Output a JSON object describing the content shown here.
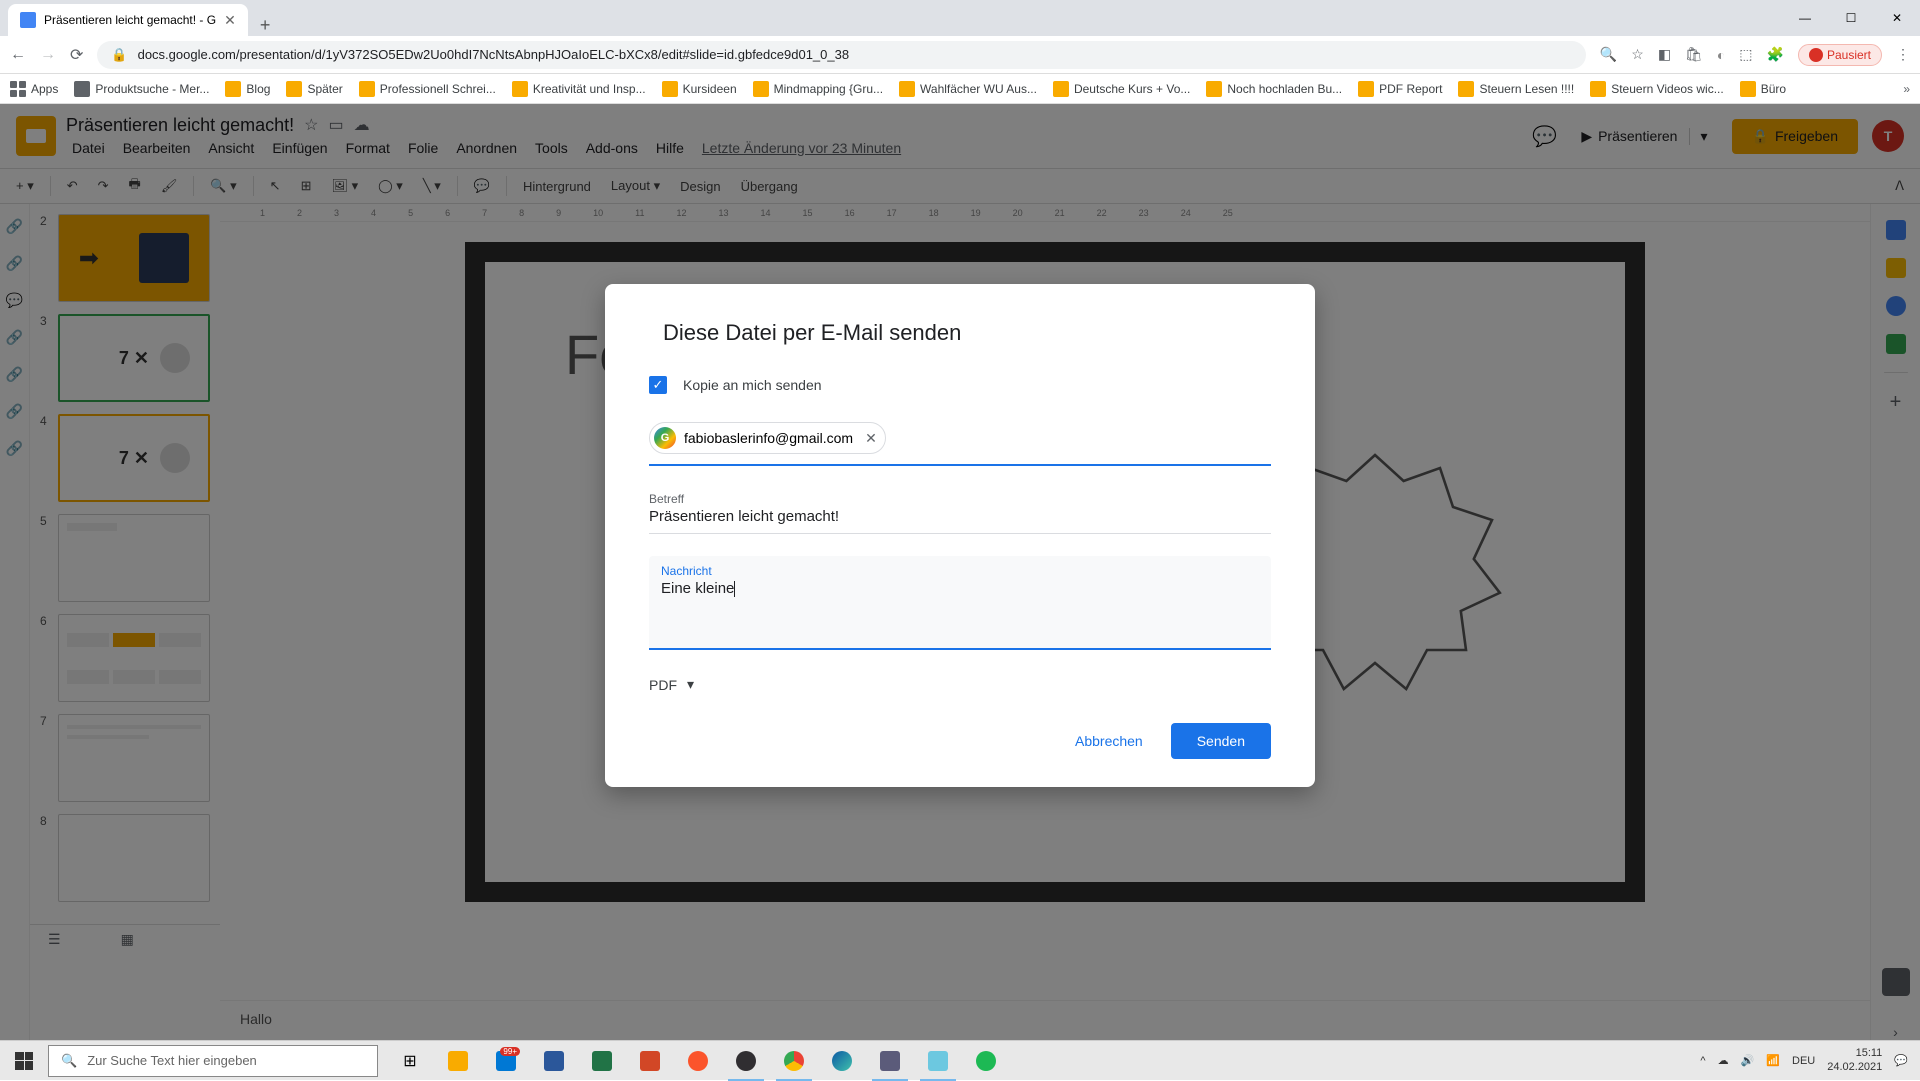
{
  "browser": {
    "tab_title": "Präsentieren leicht gemacht! - G",
    "url": "docs.google.com/presentation/d/1yV372SO5EDw2Uo0hdI7NcNtsAbnpHJOaIoELC-bXCx8/edit#slide=id.gbfedce9d01_0_38",
    "profile_status": "Pausiert",
    "window": {
      "minimize": "—",
      "maximize": "☐",
      "close": "✕"
    }
  },
  "bookmarks": {
    "apps": "Apps",
    "items": [
      "Produktsuche - Mer...",
      "Blog",
      "Später",
      "Professionell Schrei...",
      "Kreativität und Insp...",
      "Kursideen",
      "Mindmapping {Gru...",
      "Wahlfächer WU Aus...",
      "Deutsche Kurs + Vo...",
      "Noch hochladen Bu...",
      "PDF Report",
      "Steuern Lesen !!!!",
      "Steuern Videos wic...",
      "Büro"
    ]
  },
  "slides": {
    "doc_title": "Präsentieren leicht gemacht!",
    "menus": [
      "Datei",
      "Bearbeiten",
      "Ansicht",
      "Einfügen",
      "Format",
      "Folie",
      "Anordnen",
      "Tools",
      "Add-ons",
      "Hilfe"
    ],
    "last_edit": "Letzte Änderung vor 23 Minuten",
    "present": "Präsentieren",
    "share": "Freigeben",
    "toolbar": {
      "background": "Hintergrund",
      "layout": "Layout",
      "design": "Design",
      "transition": "Übergang"
    },
    "ruler": [
      "1",
      "2",
      "3",
      "4",
      "5",
      "6",
      "7",
      "8",
      "9",
      "10",
      "11",
      "12",
      "13",
      "14",
      "15",
      "16",
      "17",
      "18",
      "19",
      "20",
      "21",
      "22",
      "23",
      "24",
      "25"
    ],
    "thumbs": [
      {
        "n": "2",
        "label": ""
      },
      {
        "n": "3",
        "label": "7 ✕"
      },
      {
        "n": "4",
        "label": "7 ✕"
      },
      {
        "n": "5",
        "label": ""
      },
      {
        "n": "6",
        "label": ""
      },
      {
        "n": "7",
        "label": ""
      },
      {
        "n": "8",
        "label": ""
      }
    ],
    "slide_heading": "Fo",
    "speaker_notes": "Hallo"
  },
  "modal": {
    "title": "Diese Datei per E-Mail senden",
    "copy_self": "Kopie an mich senden",
    "recipient": "fabiobaslerinfo@gmail.com",
    "subject_label": "Betreff",
    "subject_value": "Präsentieren leicht gemacht!",
    "message_label": "Nachricht",
    "message_value": "Eine kleine",
    "format": "PDF",
    "cancel": "Abbrechen",
    "send": "Senden"
  },
  "taskbar": {
    "search_placeholder": "Zur Suche Text hier eingeben",
    "badge": "99+",
    "lang": "DEU",
    "time": "15:11",
    "date": "24.02.2021"
  }
}
